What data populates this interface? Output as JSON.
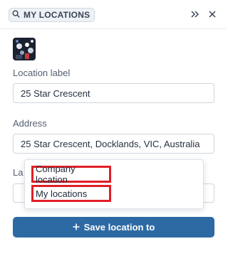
{
  "header": {
    "title": "MY LOCATIONS",
    "expand_icon": "double-chevron-right-icon",
    "close_icon": "close-icon"
  },
  "form": {
    "label_caption": "Location label",
    "label_value": "25 Star Crescent",
    "address_caption": "Address",
    "address_value": "25 Star Crescent, Docklands, VIC, Australia",
    "third_caption_partial": "La"
  },
  "dropdown": {
    "options": [
      "Company location",
      "My locations"
    ]
  },
  "save_button": {
    "label": "Save location to",
    "icon": "plus-icon"
  },
  "colors": {
    "accent": "#2d6aa3",
    "highlight": "#e01f26"
  }
}
